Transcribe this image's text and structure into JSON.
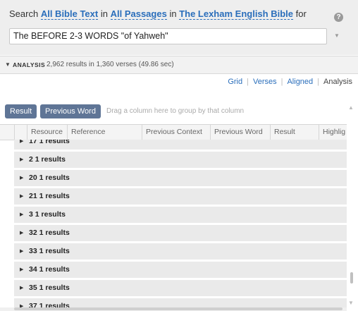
{
  "search": {
    "prefix": "Search",
    "scope": "All Bible Text",
    "in1": "in",
    "range": "All Passages",
    "in2": "in",
    "resource": "The Lexham English Bible",
    "suffix": "for",
    "help": "?",
    "query": "The BEFORE 2-3 WORDS \"of Yahweh\""
  },
  "analysis": {
    "label": "ANALYSIS",
    "summary": "2,962 results in 1,360 verses (49.86 sec)"
  },
  "views": [
    "Grid",
    "Verses",
    "Aligned",
    "Analysis"
  ],
  "group_chips": [
    "Result",
    "Previous Word"
  ],
  "drag_hint": "Drag a column here to group by that column",
  "columns": [
    "Resource",
    "Reference",
    "Previous Context",
    "Previous Word",
    "Result",
    "Highlig"
  ],
  "rows": [
    "17  1 results",
    "2  1 results",
    "20  1 results",
    "21  1 results",
    "3  1 results",
    "32  1 results",
    "33  1 results",
    "34  1 results",
    "35  1 results",
    "37  1 results"
  ]
}
